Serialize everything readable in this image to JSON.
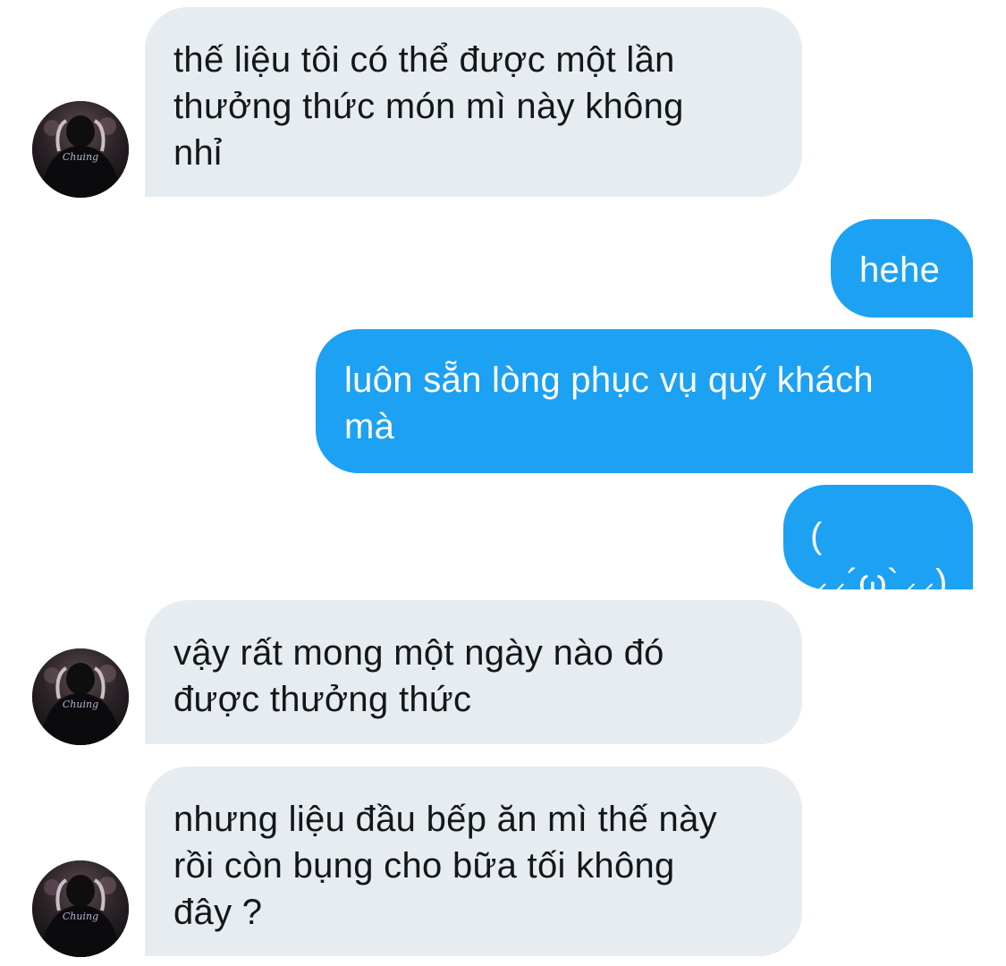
{
  "messages": [
    {
      "direction": "incoming",
      "text": "thế liệu tôi có thể được một lần\nthưởng thức món mì này không\nnhỉ"
    },
    {
      "direction": "outgoing",
      "text": "hehe"
    },
    {
      "direction": "outgoing",
      "text": "luôn sẵn lòng phục vụ quý khách\nmà"
    },
    {
      "direction": "outgoing",
      "text": "( ⸝⸝´ω`⸝⸝)"
    },
    {
      "direction": "incoming",
      "text": "vậy rất mong một ngày nào đó\nđược thưởng thức"
    },
    {
      "direction": "incoming",
      "text": "nhưng liệu đầu bếp ăn mì thế này\nrồi còn bụng cho bữa tối không\nđây ?"
    }
  ],
  "avatar": {
    "label": "Chuing",
    "icon": "person-back-photo"
  },
  "colors": {
    "incoming_bubble": "#e6ecf0",
    "outgoing_bubble": "#1da1f2",
    "incoming_text": "#14171a",
    "outgoing_text": "#ffffff"
  }
}
